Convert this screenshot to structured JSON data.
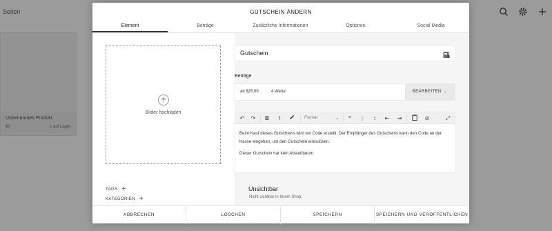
{
  "background": {
    "title": "Seiten",
    "product": {
      "name": "Unbenanntes Produkt",
      "price": "$0",
      "stock": "1 auf Lager"
    },
    "icons": [
      "search-icon",
      "gear-icon",
      "plus-icon"
    ]
  },
  "modal": {
    "title": "GUTSCHEIN ÄNDERN",
    "tabs": [
      {
        "label": "Element",
        "active": true
      },
      {
        "label": "Beträge",
        "active": false
      },
      {
        "label": "Zusätzliche Informationen",
        "active": false
      },
      {
        "label": "Optionen",
        "active": false
      },
      {
        "label": "Social Media",
        "active": false
      }
    ],
    "upload_label": "Bilder hochladen",
    "tags_label": "TAGS",
    "categories_label": "KATEGORIEN",
    "name_value": "Gutschein",
    "prices_label": "Beträge",
    "price_text": "ab $25.00",
    "price_sep": "·",
    "price_count": "4 Werte",
    "edit_button": "BEARBEITEN →",
    "format_placeholder": "Format",
    "description": [
      "Beim Kauf dieses Gutscheins wird ein Code erstellt. Der Empfänger des Gutscheins kann den Code an der Kasse eingeben, um den Gutschein einzulösen.",
      "Dieser Gutschein hat kein Ablaufdatum."
    ],
    "visibility_title": "Unsichtbar",
    "visibility_sub": "Nicht sichtbar in Ihrem Shop.",
    "footer": {
      "cancel": "ABBRECHEN",
      "delete": "LÖSCHEN",
      "save": "SPEICHERN",
      "save_publish": "SPEICHERN UND VERÖFFENTLICHEN"
    }
  }
}
